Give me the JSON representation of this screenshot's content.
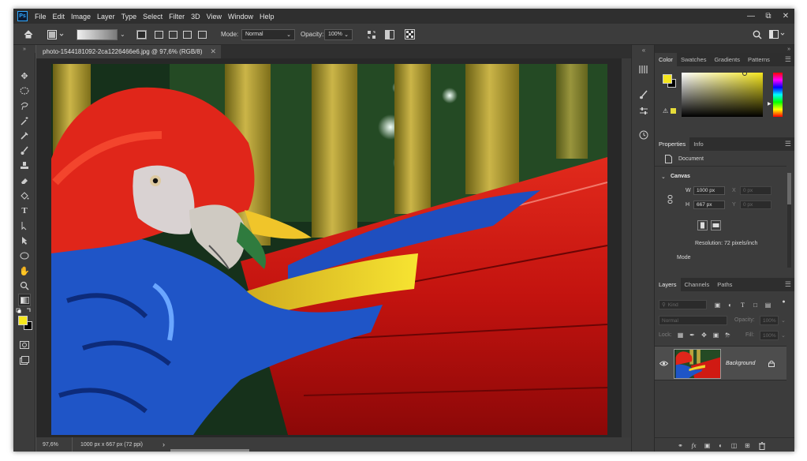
{
  "app": {
    "logo": "Ps",
    "menu": [
      "File",
      "Edit",
      "Image",
      "Layer",
      "Type",
      "Select",
      "Filter",
      "3D",
      "View",
      "Window",
      "Help"
    ]
  },
  "options": {
    "mode_label": "Mode:",
    "mode_value": "Normal",
    "opacity_label": "Opacity:",
    "opacity_value": "100%"
  },
  "document": {
    "tab_title": "photo-1544181092-2ca1226466e6.jpg @ 97,6% (RGB/8)",
    "zoom": "97,6%",
    "info": "1000 px x 667 px (72 ppi)"
  },
  "colors": {
    "foreground": "#f5e61e",
    "background": "#000000",
    "accent": "#31a8ff"
  },
  "color_panel": {
    "tabs": [
      "Color",
      "Swatches",
      "Gradients",
      "Patterns"
    ],
    "active": "Color"
  },
  "properties_panel": {
    "tabs": [
      "Properties",
      "Info"
    ],
    "document_label": "Document",
    "canvas_label": "Canvas",
    "w_label": "W",
    "w_value": "1000 px",
    "h_label": "H",
    "h_value": "667 px",
    "x_label": "X",
    "x_value": "0 px",
    "y_label": "Y",
    "y_value": "0 px",
    "resolution": "Resolution: 72 pixels/inch",
    "mode_label": "Mode"
  },
  "layers_panel": {
    "tabs": [
      "Layers",
      "Channels",
      "Paths"
    ],
    "kind_placeholder": "Kind",
    "blend_mode": "Normal",
    "opacity_label": "Opacity:",
    "opacity_value": "100%",
    "lock_label": "Lock:",
    "fill_label": "Fill:",
    "fill_value": "100%",
    "layer_name": "Background"
  }
}
